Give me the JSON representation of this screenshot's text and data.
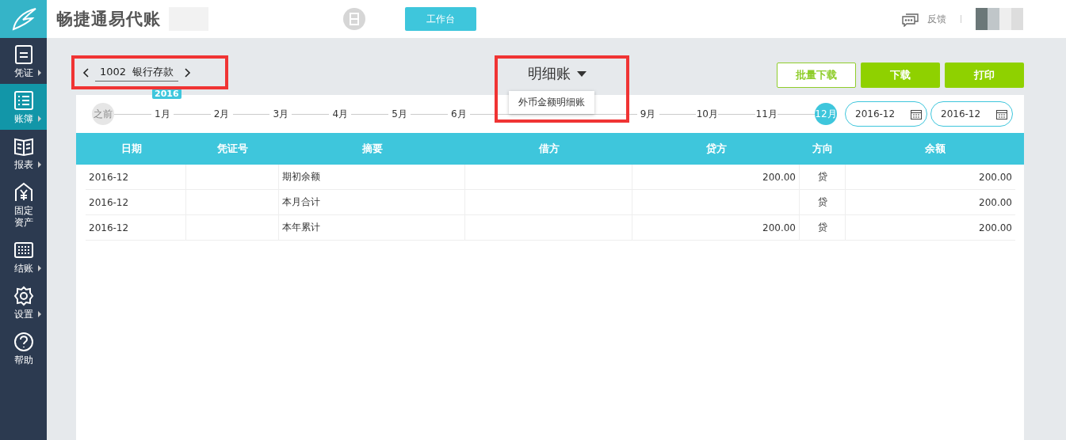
{
  "header": {
    "app_name": "畅捷通易代账",
    "workbench_button": "工作台",
    "feedback": "反馈"
  },
  "sidebar": {
    "items": [
      {
        "label": "凭证",
        "selected": false,
        "submenu": true
      },
      {
        "label": "账簿",
        "selected": true,
        "submenu": true
      },
      {
        "label": "报表",
        "selected": false,
        "submenu": true
      },
      {
        "label": "固定资产",
        "selected": false,
        "submenu": false
      },
      {
        "label": "结账",
        "selected": false,
        "submenu": true
      },
      {
        "label": "设置",
        "selected": false,
        "submenu": true
      },
      {
        "label": "帮助",
        "selected": false,
        "submenu": false
      }
    ]
  },
  "account": {
    "code": "1002",
    "name": "银行存款",
    "year": "2016"
  },
  "ledger_menu": {
    "title": "明细账",
    "options": [
      "外币金额明细账"
    ]
  },
  "buttons": [
    {
      "label": "批量下载",
      "kind": "outline"
    },
    {
      "label": "下载",
      "kind": "solid"
    },
    {
      "label": "打印",
      "kind": "solid"
    }
  ],
  "timeline": [
    {
      "label": "之前",
      "selected": false,
      "kind": "start"
    },
    {
      "label": "1月",
      "selected": false,
      "kind": "month"
    },
    {
      "label": "2月",
      "selected": false,
      "kind": "month"
    },
    {
      "label": "3月",
      "selected": false,
      "kind": "month"
    },
    {
      "label": "4月",
      "selected": false,
      "kind": "month"
    },
    {
      "label": "5月",
      "selected": false,
      "kind": "month"
    },
    {
      "label": "6月",
      "selected": false,
      "kind": "month"
    },
    {
      "label": "9月",
      "selected": false,
      "kind": "month"
    },
    {
      "label": "10月",
      "selected": false,
      "kind": "month"
    },
    {
      "label": "11月",
      "selected": false,
      "kind": "month"
    },
    {
      "label": "12月",
      "selected": true,
      "kind": "month"
    }
  ],
  "period": {
    "from": "2016-12",
    "to": "2016-12"
  },
  "table": {
    "columns": [
      "日期",
      "凭证号",
      "摘要",
      "借方",
      "贷方",
      "方向",
      "余额"
    ],
    "rows": [
      [
        "2016-12",
        "",
        "期初余额",
        "",
        "200.00",
        "贷",
        "200.00"
      ],
      [
        "2016-12",
        "",
        "本月合计",
        "",
        "",
        "贷",
        "200.00"
      ],
      [
        "2016-12",
        "",
        "本年累计",
        "",
        "200.00",
        "贷",
        "200.00"
      ]
    ]
  }
}
